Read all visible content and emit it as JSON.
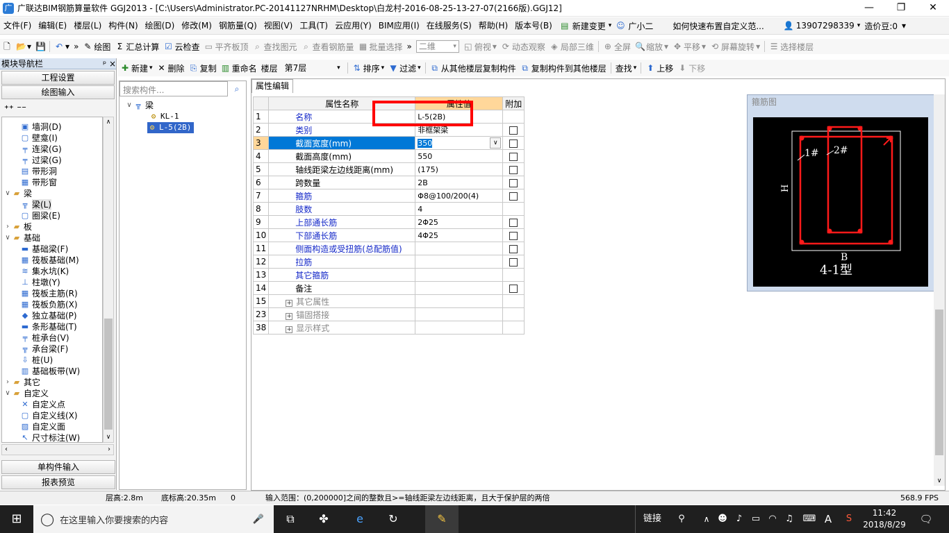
{
  "window": {
    "title": "广联达BIM钢筋算量软件 GGJ2013 - [C:\\Users\\Administrator.PC-20141127NRHM\\Desktop\\白龙村-2016-08-25-13-27-07(2166版).GGJ12]"
  },
  "menu": {
    "items": [
      "文件(F)",
      "编辑(E)",
      "楼层(L)",
      "构件(N)",
      "绘图(D)",
      "修改(M)",
      "钢筋量(Q)",
      "视图(V)",
      "工具(T)",
      "云应用(Y)",
      "BIM应用(I)",
      "在线服务(S)",
      "帮助(H)",
      "版本号(B)"
    ],
    "new_change": "新建变更",
    "assistant": "广小二",
    "tip": "如何快速布置自定义范...",
    "phone": "13907298339",
    "credits": "造价豆:0"
  },
  "toolbar1": {
    "draw": "绘图",
    "calc": "汇总计算",
    "cloud_check": "云检查",
    "flatten": "平齐板顶",
    "find": "查找图元",
    "view_rebar": "查看钢筋量",
    "batch_select": "批量选择",
    "view_mode": "二维",
    "top_view": "俯视",
    "dynamic": "动态观察",
    "local3d": "局部三维",
    "fullscreen": "全屏",
    "zoom": "缩放",
    "pan": "平移",
    "rotate": "屏幕旋转",
    "select_floor": "选择楼层"
  },
  "nav": {
    "header": "模块导航栏",
    "pin": "ᵖ",
    "close": "×",
    "project_settings": "工程设置",
    "drawing_input": "绘图输入",
    "single_input": "单构件输入",
    "report_preview": "报表预览",
    "tree": [
      {
        "label": "墙洞(D)",
        "level": 2
      },
      {
        "label": "壁龛(I)",
        "level": 2
      },
      {
        "label": "连梁(G)",
        "level": 2
      },
      {
        "label": "过梁(G)",
        "level": 2
      },
      {
        "label": "带形洞",
        "level": 2
      },
      {
        "label": "带形窗",
        "level": 2
      },
      {
        "label": "梁",
        "level": 1,
        "expand": "∨"
      },
      {
        "label": "梁(L)",
        "level": 2
      },
      {
        "label": "圈梁(E)",
        "level": 2
      },
      {
        "label": "板",
        "level": 1,
        "expand": "›"
      },
      {
        "label": "基础",
        "level": 1,
        "expand": "∨"
      },
      {
        "label": "基础梁(F)",
        "level": 2
      },
      {
        "label": "筏板基础(M)",
        "level": 2
      },
      {
        "label": "集水坑(K)",
        "level": 2
      },
      {
        "label": "柱墩(Y)",
        "level": 2
      },
      {
        "label": "筏板主筋(R)",
        "level": 2
      },
      {
        "label": "筏板负筋(X)",
        "level": 2
      },
      {
        "label": "独立基础(P)",
        "level": 2
      },
      {
        "label": "条形基础(T)",
        "level": 2
      },
      {
        "label": "桩承台(V)",
        "level": 2
      },
      {
        "label": "承台梁(F)",
        "level": 2
      },
      {
        "label": "桩(U)",
        "level": 2
      },
      {
        "label": "基础板带(W)",
        "level": 2
      },
      {
        "label": "其它",
        "level": 1,
        "expand": "›"
      },
      {
        "label": "自定义",
        "level": 1,
        "expand": "∨"
      },
      {
        "label": "自定义点",
        "level": 2
      },
      {
        "label": "自定义线(X)",
        "level": 2
      },
      {
        "label": "自定义面",
        "level": 2
      },
      {
        "label": "尺寸标注(W)",
        "level": 2
      }
    ]
  },
  "toolbar2": {
    "new": "新建",
    "delete": "删除",
    "copy": "复制",
    "rename": "重命名",
    "floor_label": "楼层",
    "floor": "第7层",
    "sort": "排序",
    "filter": "过滤",
    "copy_from": "从其他楼层复制构件",
    "copy_to": "复制构件到其他楼层",
    "find": "查找",
    "move_up": "上移",
    "move_down": "下移"
  },
  "components": {
    "search_placeholder": "搜索构件...",
    "group": "梁",
    "items": [
      "KL-1",
      "L-5(2B)"
    ]
  },
  "props": {
    "tab": "属性编辑",
    "headers": {
      "name": "属性名称",
      "value": "属性值",
      "extra": "附加"
    },
    "rows": [
      {
        "no": "1",
        "name": "名称",
        "value": "L-5(2B)",
        "blue": true,
        "cb": false
      },
      {
        "no": "2",
        "name": "类别",
        "value": "非框架梁",
        "blue": true,
        "cb": true
      },
      {
        "no": "3",
        "name": "截面宽度(mm)",
        "value": "350",
        "blue": true,
        "cb": true,
        "selected": true
      },
      {
        "no": "4",
        "name": "截面高度(mm)",
        "value": "550",
        "blue": false,
        "cb": true
      },
      {
        "no": "5",
        "name": "轴线距梁左边线距离(mm)",
        "value": "(175)",
        "blue": false,
        "cb": true
      },
      {
        "no": "6",
        "name": "跨数量",
        "value": "2B",
        "blue": false,
        "cb": true
      },
      {
        "no": "7",
        "name": "箍筋",
        "value": "Φ8@100/200(4)",
        "blue": true,
        "cb": true
      },
      {
        "no": "8",
        "name": "肢数",
        "value": "4",
        "blue": true,
        "cb": false
      },
      {
        "no": "9",
        "name": "上部通长筋",
        "value": "2Φ25",
        "blue": true,
        "cb": true
      },
      {
        "no": "10",
        "name": "下部通长筋",
        "value": "4Φ25",
        "blue": true,
        "cb": true
      },
      {
        "no": "11",
        "name": "侧面构造或受扭筋(总配筋值)",
        "value": "",
        "blue": true,
        "cb": true
      },
      {
        "no": "12",
        "name": "拉筋",
        "value": "",
        "blue": true,
        "cb": true
      },
      {
        "no": "13",
        "name": "其它箍筋",
        "value": "",
        "blue": true,
        "cb": false
      },
      {
        "no": "14",
        "name": "备注",
        "value": "",
        "blue": false,
        "cb": true
      },
      {
        "no": "15",
        "name": "其它属性",
        "value": "",
        "gray": true,
        "group": true
      },
      {
        "no": "23",
        "name": "锚固搭接",
        "value": "",
        "gray": true,
        "group": true
      },
      {
        "no": "38",
        "name": "显示样式",
        "value": "",
        "gray": true,
        "group": true
      }
    ]
  },
  "stirrup": {
    "caption": "箍筋图",
    "label1": "1#",
    "label2": "2#",
    "h": "H",
    "b": "B",
    "type": "4-1型"
  },
  "status": {
    "floor_height": "层高:2.8m",
    "bottom_elev": "底标高:20.35m",
    "zero": "0",
    "hint": "输入范围：(0,200000]之间的整数且>=轴线距梁左边线距离，且大于保护层的两倍",
    "fps": "568.9 FPS"
  },
  "taskbar": {
    "search": "在这里输入你要搜索的内容",
    "link": "链接",
    "time": "11:42",
    "date": "2018/8/29",
    "ime": "A"
  },
  "colors": {
    "accent": "#1428c8",
    "red": "#ff0000",
    "selected": "#0078d7"
  }
}
